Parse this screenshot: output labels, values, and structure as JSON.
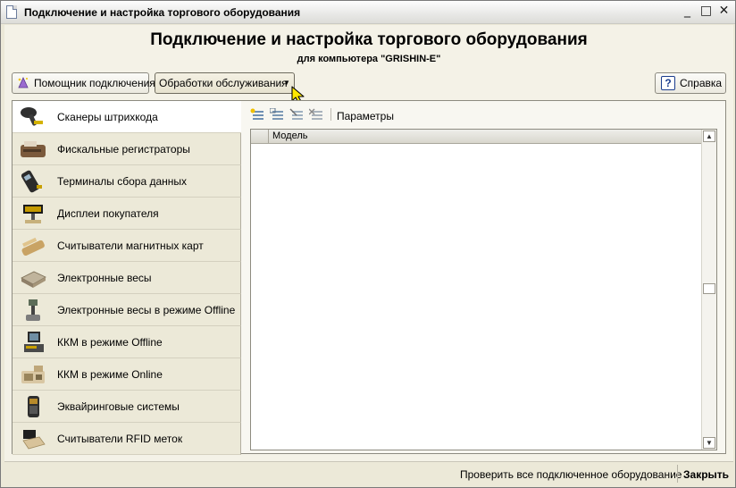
{
  "window": {
    "title": "Подключение и настройка торгового оборудования",
    "controls": {
      "minimize": "_",
      "maximize": "□",
      "close": "✕"
    }
  },
  "header": {
    "title": "Подключение и настройка торгового оборудования",
    "subtitle": "для компьютера \"GRISHIN-E\""
  },
  "buttons": {
    "wizard": "Помощник подключения",
    "service": "Обработки обслуживания",
    "help": "Справка",
    "help_glyph": "?"
  },
  "nav": {
    "items": [
      {
        "label": "Сканеры штрихкода",
        "icon": "barcode-scanner-icon",
        "active": true
      },
      {
        "label": "Фискальные регистраторы",
        "icon": "fiscal-printer-icon"
      },
      {
        "label": "Терминалы сбора данных",
        "icon": "data-terminal-icon"
      },
      {
        "label": "Дисплеи покупателя",
        "icon": "customer-display-icon"
      },
      {
        "label": "Считыватели магнитных карт",
        "icon": "card-reader-icon"
      },
      {
        "label": "Электронные весы",
        "icon": "scale-icon"
      },
      {
        "label": "Электронные весы в режиме Offline",
        "icon": "offline-scale-icon"
      },
      {
        "label": "ККМ в режиме Offline",
        "icon": "pos-terminal-icon"
      },
      {
        "label": "ККМ в режиме Online",
        "icon": "cash-register-icon"
      },
      {
        "label": "Эквайринговые системы",
        "icon": "payment-terminal-icon"
      },
      {
        "label": "Считыватели RFID меток",
        "icon": "rfid-reader-icon"
      }
    ]
  },
  "toolbar": {
    "params_label": "Параметры"
  },
  "table": {
    "columns": [
      "Модель"
    ],
    "rows": []
  },
  "status": {
    "check_all": "Проверить все подключенное оборудование",
    "close": "Закрыть"
  },
  "colors": {
    "accent": "#1b3d8e",
    "window_bg": "#ece9d8"
  }
}
